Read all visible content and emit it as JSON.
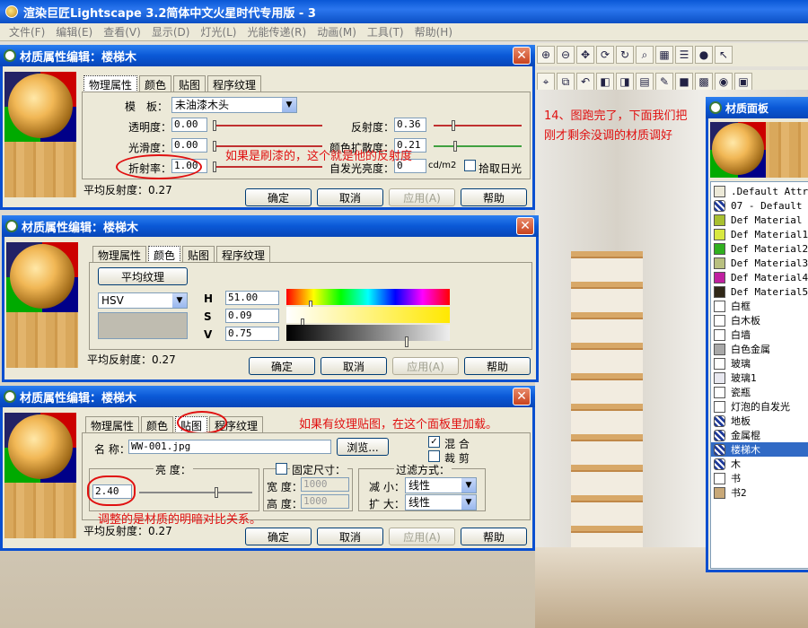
{
  "app": {
    "title": "渲染巨匠Lightscape 3.2简体中文火星时代专用版 - 3",
    "menu": [
      "文件(F)",
      "编辑(E)",
      "查看(V)",
      "显示(D)",
      "灯光(L)",
      "光能传递(R)",
      "动画(M)",
      "工具(T)",
      "帮助(H)"
    ]
  },
  "annotation_right": [
    "14、图跑完了，下面我们把",
    "刚才剩余没调的材质调好"
  ],
  "dialog_common": {
    "title": "材质属性编辑：楼梯木",
    "tabs": [
      "物理属性",
      "颜色",
      "贴图",
      "程序纹理"
    ],
    "avg_reflect": "平均反射度：0.27",
    "ok": "确定",
    "cancel": "取消",
    "apply": "应用(A)",
    "help": "帮助"
  },
  "dlg1": {
    "template_label": "模　板：",
    "template_value": "未油漆木头",
    "transparency_label": "透明度：",
    "transparency": "0.00",
    "smoothness_label": "光滑度：",
    "smoothness": "0.00",
    "refraction_label": "折射率：",
    "refraction": "1.00",
    "reflectance_label": "反射度：",
    "reflectance": "0.36",
    "color_bleed_label": "颜色扩散度：",
    "color_bleed": "0.21",
    "luminance_label": "自发光亮度：",
    "luminance": "0",
    "luminance_unit": "cd/m2",
    "pick_daylight": "拾取日光",
    "annotation": "如果是刷漆的，这个就是他的反射度"
  },
  "dlg2": {
    "avg_texture_btn": "平均纹理",
    "colorspace": "HSV",
    "h_label": "H",
    "h": "51.00",
    "h_fraction": 0.14,
    "s_label": "S",
    "s": "0.09",
    "s_fraction": 0.09,
    "v_label": "V",
    "v": "0.75",
    "v_fraction": 0.75,
    "swatch_color": "#bfbcb0"
  },
  "dlg3": {
    "name_label": "名 称：",
    "name_value": "WW-001.jpg",
    "browse": "浏览...",
    "blend": "混 合",
    "crop": "裁 剪",
    "brightness_group": "亮 度：",
    "brightness": "2.40",
    "fixed_size": "固定尺寸：",
    "width_label": "宽 度：",
    "width": "1000",
    "height_label": "高 度：",
    "height": "1000",
    "filter_group": "过滤方式：",
    "min_label": "减 小：",
    "min_value": "线性",
    "mag_label": "扩 大：",
    "mag_value": "线性",
    "annotation1": "如果有纹理贴图，在这个面板里加载。",
    "annotation2": "调整的是材质的明暗对比关系。"
  },
  "materials_panel": {
    "title": "材质面板",
    "items": [
      {
        "name": ".Default Attr",
        "color": "#ece9d8",
        "texture": false
      },
      {
        "name": "07 - Default",
        "color": "#ffffff",
        "texture": true
      },
      {
        "name": "Def Material",
        "color": "#a8c030",
        "texture": false
      },
      {
        "name": "Def Material1",
        "color": "#d8e840",
        "texture": false
      },
      {
        "name": "Def Material2",
        "color": "#30b020",
        "texture": false
      },
      {
        "name": "Def Material3",
        "color": "#b8c080",
        "texture": false
      },
      {
        "name": "Def Material4",
        "color": "#c020a0",
        "texture": false
      },
      {
        "name": "Def Material5",
        "color": "#302818",
        "texture": false
      },
      {
        "name": "白框",
        "color": "#ffffff",
        "texture": false
      },
      {
        "name": "白木板",
        "color": "#ffffff",
        "texture": false
      },
      {
        "name": "白墙",
        "color": "#ffffff",
        "texture": false
      },
      {
        "name": "白色金属",
        "color": "#a8a8a8",
        "texture": false
      },
      {
        "name": "玻璃",
        "color": "#ffffff",
        "texture": false
      },
      {
        "name": "玻璃1",
        "color": "#e8e8f0",
        "texture": false
      },
      {
        "name": "瓷瓶",
        "color": "#ffffff",
        "texture": false
      },
      {
        "name": "灯泡的自发光",
        "color": "#ffffff",
        "texture": false
      },
      {
        "name": "地板",
        "color": "#ffffff",
        "texture": true
      },
      {
        "name": "金属棍",
        "color": "#ffffff",
        "texture": true
      },
      {
        "name": "楼梯木",
        "color": "#ffffff",
        "texture": true,
        "selected": true
      },
      {
        "name": "木",
        "color": "#ffffff",
        "texture": true
      },
      {
        "name": "书",
        "color": "#ffffff",
        "texture": false
      },
      {
        "name": "书2",
        "color": "#c8a878",
        "texture": false
      }
    ]
  }
}
